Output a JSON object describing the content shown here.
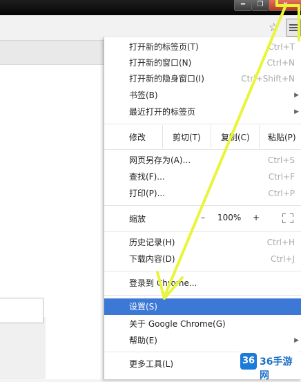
{
  "window": {
    "min_glyph": "━",
    "max_glyph": "❐",
    "close_glyph": "x"
  },
  "menu": {
    "items_top": [
      {
        "label": "打开新的标签页(T)",
        "shortcut": "Ctrl+T"
      },
      {
        "label": "打开新的窗口(N)",
        "shortcut": "Ctrl+N"
      },
      {
        "label": "打开新的隐身窗口(I)",
        "shortcut": "Ctrl+Shift+N"
      },
      {
        "label": "书签(B)",
        "submenu": true
      },
      {
        "label": "最近打开的标签页",
        "submenu": true
      }
    ],
    "edit": {
      "label": "修改",
      "cut": "剪切(T)",
      "copy": "复制(C)",
      "paste": "粘贴(P)"
    },
    "items_page": [
      {
        "label": "网页另存为(A)...",
        "shortcut": "Ctrl+S"
      },
      {
        "label": "查找(F)...",
        "shortcut": "Ctrl+F"
      },
      {
        "label": "打印(P)...",
        "shortcut": "Ctrl+P"
      }
    ],
    "zoom": {
      "label": "缩放",
      "minus": "–",
      "value": "100%",
      "plus": "+",
      "fullscreen_icon": "fullscreen-icon"
    },
    "items_history": [
      {
        "label": "历史记录(H)",
        "shortcut": "Ctrl+H"
      },
      {
        "label": "下载内容(D)",
        "shortcut": "Ctrl+J"
      }
    ],
    "signin": "登录到 Chrome...",
    "settings": "设置(S)",
    "about": "关于 Google Chrome(G)",
    "help": "帮助(E)",
    "more_tools": "更多工具(L)"
  },
  "annotation": {
    "arrow_color": "#e9f53a"
  },
  "watermark": {
    "logo": "36",
    "text": "36手游网"
  }
}
